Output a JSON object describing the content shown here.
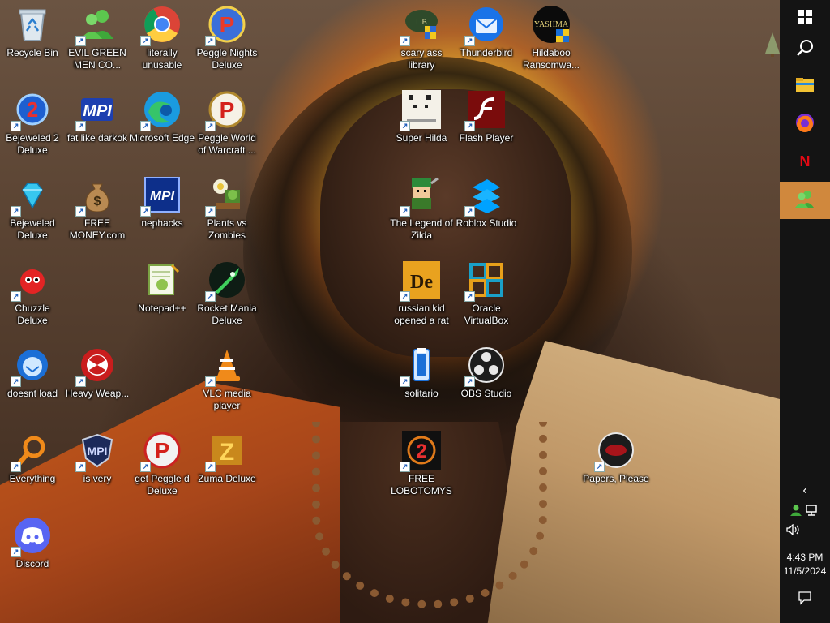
{
  "desktop": {
    "icons": [
      {
        "label": "Recycle Bin",
        "icon": "recycle-bin-icon",
        "shortcut": false
      },
      {
        "label": "EVIL GREEN MEN CO...",
        "icon": "green-people-icon",
        "shortcut": true
      },
      {
        "label": "literally unusable",
        "icon": "chrome-icon",
        "shortcut": true
      },
      {
        "label": "Peggle Nights Deluxe",
        "icon": "peggle-icon",
        "shortcut": true
      },
      {
        "label": "Bejeweled 2 Deluxe",
        "icon": "bejeweled2-icon",
        "shortcut": true
      },
      {
        "label": "fat like darkok",
        "icon": "mpi-icon",
        "shortcut": true
      },
      {
        "label": "Microsoft Edge",
        "icon": "edge-icon",
        "shortcut": true
      },
      {
        "label": "Peggle World of Warcraft ...",
        "icon": "peggle-icon",
        "shortcut": true
      },
      {
        "label": "Bejeweled Deluxe",
        "icon": "diamond-icon",
        "shortcut": true
      },
      {
        "label": "FREE MONEY.com",
        "icon": "money-bag-icon",
        "shortcut": true
      },
      {
        "label": "nephacks",
        "icon": "mpi-blue-icon",
        "shortcut": true
      },
      {
        "label": "Plants vs Zombies",
        "icon": "plant-icon",
        "shortcut": true
      },
      {
        "label": "Chuzzle Deluxe",
        "icon": "chuzzle-icon",
        "shortcut": true
      },
      {
        "label": "Notepad++",
        "icon": "notepad-icon",
        "shortcut": false
      },
      {
        "label": "Rocket Mania Deluxe",
        "icon": "rocket-icon",
        "shortcut": true
      },
      {
        "label": "doesnt load",
        "icon": "bird-icon",
        "shortcut": true
      },
      {
        "label": "Heavy Weap...",
        "icon": "radiation-icon",
        "shortcut": true
      },
      {
        "label": "VLC media player",
        "icon": "vlc-icon",
        "shortcut": true
      },
      {
        "label": "Everything",
        "icon": "magnifier-icon",
        "shortcut": true
      },
      {
        "label": "is very",
        "icon": "shield-icon",
        "shortcut": true
      },
      {
        "label": "get Peggle d Deluxe",
        "icon": "peggle-icon",
        "shortcut": true
      },
      {
        "label": "Zuma Deluxe",
        "icon": "zuma-icon",
        "shortcut": true
      },
      {
        "label": "Discord",
        "icon": "discord-icon",
        "shortcut": true
      },
      {
        "label": "scary ass library",
        "icon": "library-icon",
        "shortcut": true
      },
      {
        "label": "Thunderbird",
        "icon": "thunderbird-icon",
        "shortcut": true
      },
      {
        "label": "Hildaboo Ransomwa...",
        "icon": "yashma-icon",
        "shortcut": false
      },
      {
        "label": "Super Hilda",
        "icon": "pixel-cat-icon",
        "shortcut": true
      },
      {
        "label": "Flash Player",
        "icon": "flash-icon",
        "shortcut": true
      },
      {
        "label": "The Legend of Zilda",
        "icon": "zelda-icon",
        "shortcut": true
      },
      {
        "label": "Roblox Studio",
        "icon": "roblox-icon",
        "shortcut": true
      },
      {
        "label": "russian kid opened a rat",
        "icon": "de-icon",
        "shortcut": true
      },
      {
        "label": "Oracle VirtualBox",
        "icon": "virtualbox-icon",
        "shortcut": true
      },
      {
        "label": "solitario",
        "icon": "solitaire-icon",
        "shortcut": true
      },
      {
        "label": "OBS Studio",
        "icon": "obs-icon",
        "shortcut": true
      },
      {
        "label": "FREE LOBOTOMYS",
        "icon": "bejeweled2-dark-icon",
        "shortcut": true
      },
      {
        "label": "Papers, Please",
        "icon": "papers-please-icon",
        "shortcut": true
      }
    ]
  },
  "taskbar": {
    "start": "windows-icon",
    "search": "search-icon",
    "pinned": [
      {
        "name": "file-explorer-icon",
        "active": false
      },
      {
        "name": "firefox-icon",
        "active": false
      },
      {
        "name": "netflix-icon",
        "active": false
      },
      {
        "name": "green-people-icon",
        "active": true
      }
    ],
    "tray": {
      "time": "4:43 PM",
      "date": "11/5/2024"
    }
  },
  "colors": {
    "taskbar_bg": "#141414",
    "taskbar_active": "#d0883d",
    "shortcut_arrow": "#1a5ab8"
  }
}
